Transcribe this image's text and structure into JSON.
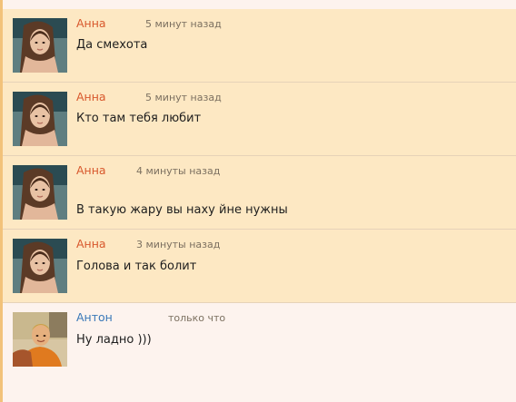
{
  "messages": [
    {
      "author": "Анна",
      "time": "5 минут назад",
      "text": "Да смехота"
    },
    {
      "author": "Анна",
      "time": "5 минут назад",
      "text": "Кто там тебя любит"
    },
    {
      "author": "Анна",
      "time": "4 минуты назад",
      "text": "В такую жару вы наху йне нужны"
    },
    {
      "author": "Анна",
      "time": "3 минуты назад",
      "text": "Голова и так болит"
    },
    {
      "author": "Антон",
      "time": "только что",
      "text": "Ну ладно )))"
    }
  ],
  "colors": {
    "unread_background": "#fde8c3",
    "read_background": "#fdf3ee",
    "author_anna": "#d8582d",
    "author_anton": "#3a78b8",
    "left_accent": "#f2c27a"
  }
}
